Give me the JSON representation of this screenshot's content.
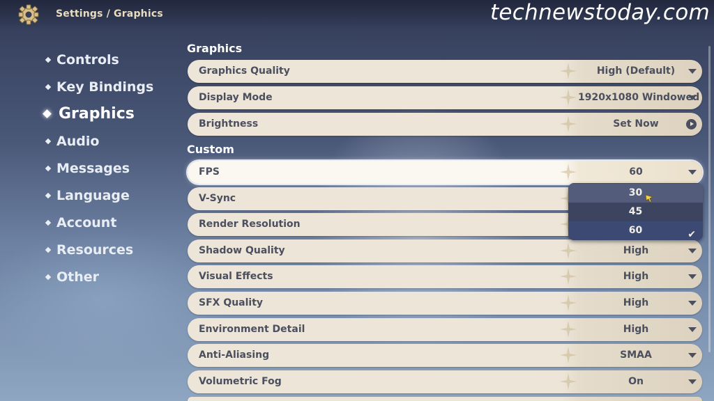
{
  "header": {
    "breadcrumb_root": "Settings",
    "breadcrumb_sep": "/",
    "breadcrumb_current": "Graphics",
    "watermark": "technewstoday.com"
  },
  "sidebar": {
    "items": [
      {
        "label": "Controls"
      },
      {
        "label": "Key Bindings"
      },
      {
        "label": "Graphics",
        "active": true
      },
      {
        "label": "Audio"
      },
      {
        "label": "Messages"
      },
      {
        "label": "Language"
      },
      {
        "label": "Account"
      },
      {
        "label": "Resources"
      },
      {
        "label": "Other"
      }
    ]
  },
  "graphics": {
    "title": "Graphics",
    "rows": [
      {
        "label": "Graphics Quality",
        "value": "High (Default)"
      },
      {
        "label": "Display Mode",
        "value": "1920x1080 Windowed"
      },
      {
        "label": "Brightness",
        "value": "Set Now"
      }
    ]
  },
  "custom": {
    "title": "Custom",
    "rows": [
      {
        "label": "FPS",
        "value": "60"
      },
      {
        "label": "V-Sync",
        "value": ""
      },
      {
        "label": "Render Resolution",
        "value": ""
      },
      {
        "label": "Shadow Quality",
        "value": "High"
      },
      {
        "label": "Visual Effects",
        "value": "High"
      },
      {
        "label": "SFX Quality",
        "value": "High"
      },
      {
        "label": "Environment Detail",
        "value": "High"
      },
      {
        "label": "Anti-Aliasing",
        "value": "SMAA"
      },
      {
        "label": "Volumetric Fog",
        "value": "On"
      }
    ]
  },
  "fps_dropdown": {
    "options": [
      "30",
      "45",
      "60"
    ],
    "hovered": "30",
    "selected": "60",
    "check": "✔"
  },
  "colors": {
    "row_bg": "#ece5d8",
    "text_dark": "#4b4f5e",
    "dropdown_bg": "#3d4460",
    "breadcrumb": "#e9ddbf"
  }
}
